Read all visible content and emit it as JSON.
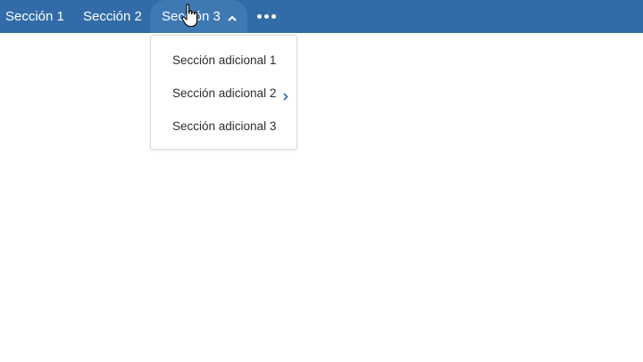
{
  "navbar": {
    "items": [
      {
        "label": "Sección 1"
      },
      {
        "label": "Sección 2"
      },
      {
        "label": "Sección 3",
        "expanded": true,
        "icon": "chevron-up-icon"
      }
    ],
    "more_icon": "more-horizontal-icon",
    "background": "#316ca8",
    "active_background": "#3f79b3"
  },
  "dropdown": {
    "items": [
      {
        "label": "Sección adicional 1"
      },
      {
        "label": "Sección adicional 2",
        "has_submenu": true,
        "icon": "chevron-right-icon"
      },
      {
        "label": "Sección adicional 3"
      }
    ],
    "chevron_color": "#316ca8"
  }
}
